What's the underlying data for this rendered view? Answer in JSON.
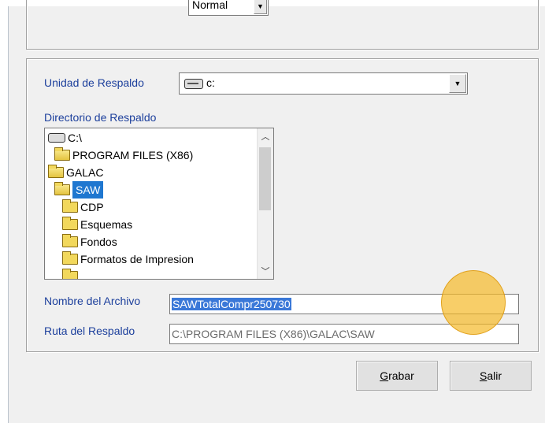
{
  "top_combo": {
    "value": "Normal"
  },
  "backup_unit": {
    "label": "Unidad de Respaldo",
    "value": "c:"
  },
  "backup_dir": {
    "label": "Directorio de Respaldo",
    "items": [
      {
        "text": "C:\\",
        "icon": "drive-icon",
        "indent": 0,
        "selected": false
      },
      {
        "text": "PROGRAM FILES (X86)",
        "icon": "open-folder-icon",
        "indent": 1,
        "selected": false
      },
      {
        "text": "GALAC",
        "icon": "open-folder-icon",
        "indent": 0,
        "selected": false
      },
      {
        "text": "SAW",
        "icon": "open-folder-icon",
        "indent": 1,
        "selected": true
      },
      {
        "text": "CDP",
        "icon": "folder-icon",
        "indent": 2,
        "selected": false
      },
      {
        "text": "Esquemas",
        "icon": "folder-icon",
        "indent": 2,
        "selected": false
      },
      {
        "text": "Fondos",
        "icon": "folder-icon",
        "indent": 2,
        "selected": false
      },
      {
        "text": "Formatos de Impresion",
        "icon": "folder-icon",
        "indent": 2,
        "selected": false
      },
      {
        "text": "",
        "icon": "folder-icon",
        "indent": 2,
        "selected": false
      }
    ]
  },
  "file_name": {
    "label": "Nombre del Archivo",
    "value": "SAWTotalCompr250730"
  },
  "backup_path": {
    "label": "Ruta del Respaldo",
    "value": "C:\\PROGRAM FILES (X86)\\GALAC\\SAW"
  },
  "buttons": {
    "save": {
      "mnemonic": "G",
      "rest": "rabar"
    },
    "exit": {
      "mnemonic": "S",
      "rest": "alir"
    }
  },
  "colors": {
    "label": "#1c3f9c",
    "selection": "#1f77d0",
    "cursor_highlight": "#f5b928"
  }
}
